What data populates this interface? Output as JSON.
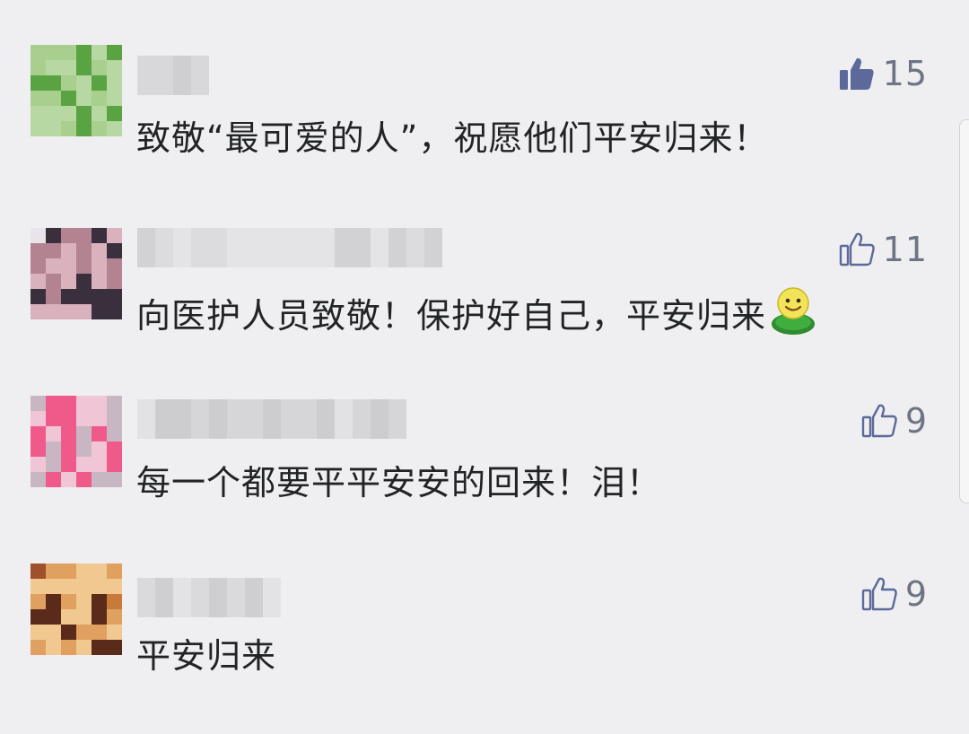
{
  "comments": [
    {
      "text": "致敬“最可爱的人”，祝愿他们平安归来！",
      "likes": "15",
      "liked": true,
      "avatar_palette": [
        "#a9cf8e",
        "#86be6b",
        "#5aa342",
        "#6daf57",
        "#b7d7a3",
        "#d7e8cd"
      ],
      "name_palette": [
        "#d8d8db",
        "#cfcfd2",
        "#e0e0e3"
      ]
    },
    {
      "text": "向医护人员致敬！保护好自己，平安归来",
      "emoji": "smiley-emoji",
      "likes": "11",
      "liked": false,
      "avatar_palette": [
        "#3a2f3d",
        "#8b5a63",
        "#d9b2bd",
        "#f0d6dc",
        "#b48392",
        "#e8e4ea"
      ],
      "name_palette": [
        "#dcdcdf",
        "#d2d2d5",
        "#e4e4e6"
      ]
    },
    {
      "text": "每一个都要平平安安的回来！泪！",
      "likes": "9",
      "liked": false,
      "avatar_palette": [
        "#f0c6d6",
        "#e9a3bd",
        "#f05a8a",
        "#ece6ee",
        "#c9b6c3",
        "#d88aa9"
      ],
      "name_palette": [
        "#d6d6d9",
        "#cdcdd0",
        "#e2e2e4"
      ]
    },
    {
      "text": "平安归来",
      "likes": "9",
      "liked": false,
      "avatar_palette": [
        "#5a2a1a",
        "#c87a3a",
        "#f0c890",
        "#a0502a",
        "#e0a060",
        "#f4e2c0"
      ],
      "name_palette": [
        "#dadadd",
        "#cfcfd2",
        "#e3e3e5"
      ]
    }
  ],
  "colors": {
    "background": "#efeff1",
    "text": "#222326",
    "like_count": "#6e7483",
    "like_active": "#5b6a9a",
    "like_outline": "#5b6a9a"
  }
}
